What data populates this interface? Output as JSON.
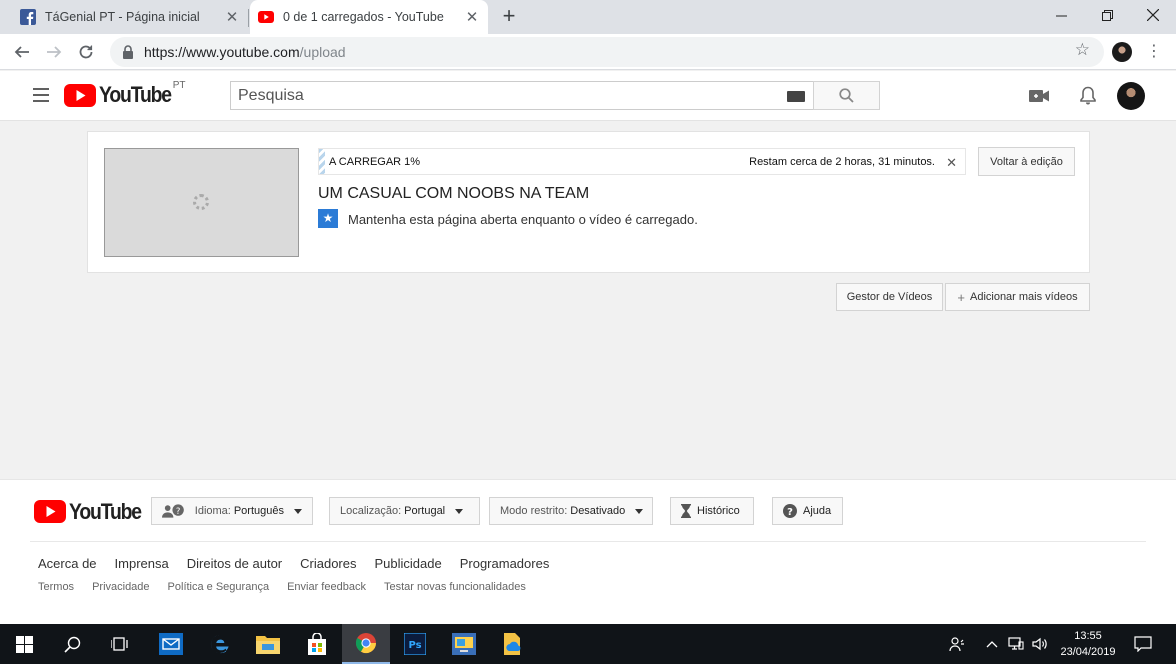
{
  "browser": {
    "tabs": [
      {
        "title": "TáGenial PT - Página inicial",
        "favicon": "facebook-icon",
        "active": false
      },
      {
        "title": "0 de 1 carregados - YouTube",
        "favicon": "youtube-icon",
        "active": true
      }
    ],
    "url_host": "https://www.youtube.com",
    "url_path": "/upload"
  },
  "header": {
    "logo_text": "YouTube",
    "country_code": "PT",
    "search_placeholder": "Pesquisa"
  },
  "upload": {
    "progress_label": "A CARREGAR 1%",
    "progress_fraction": 0.01,
    "remaining_text": "Restam cerca de 2 horas, 31 minutos.",
    "back_button": "Voltar à edição",
    "video_title": "UM CASUAL COM NOOBS NA TEAM",
    "notice": "Mantenha esta página aberta enquanto o vídeo é carregado.",
    "manager_button": "Gestor de Vídeos",
    "add_more_button": "Adicionar mais vídeos"
  },
  "footer": {
    "logo_text": "YouTube",
    "language_label": "Idioma:",
    "language_value": "Português",
    "location_label": "Localização:",
    "location_value": "Portugal",
    "restricted_label": "Modo restrito:",
    "restricted_value": "Desativado",
    "history": "Histórico",
    "help": "Ajuda",
    "links_primary": [
      "Acerca de",
      "Imprensa",
      "Direitos de autor",
      "Criadores",
      "Publicidade",
      "Programadores"
    ],
    "links_secondary": [
      "Termos",
      "Privacidade",
      "Política e Segurança",
      "Enviar feedback",
      "Testar novas funcionalidades"
    ]
  },
  "taskbar": {
    "time": "13:55",
    "date": "23/04/2019"
  },
  "colors": {
    "youtube_red": "#ff0000",
    "progress_stripe": "#b9d5ec",
    "notice_blue": "#2b7bd6"
  }
}
